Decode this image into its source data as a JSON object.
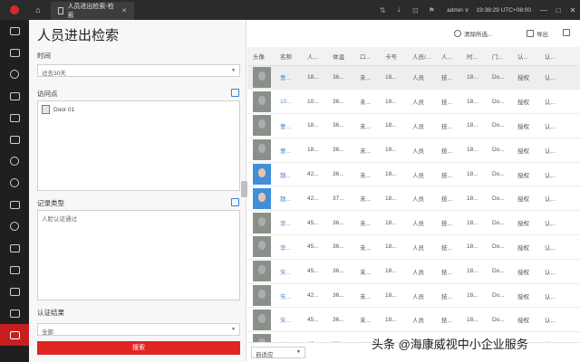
{
  "titlebar": {
    "tab_label": "人员进出检索-检索",
    "user": "admin",
    "clock": "19:38:29 UTC+08:00"
  },
  "left_rail": {
    "items": [
      "monitor-icon",
      "camera-icon",
      "map-icon",
      "image-icon",
      "report-icon",
      "event-icon",
      "face-icon",
      "person-icon",
      "document-icon",
      "time-icon",
      "vehicle-icon",
      "access-icon",
      "user-icon"
    ]
  },
  "search": {
    "page_title": "人员进出检索",
    "time_label": "时间",
    "time_value": "过去30天",
    "access_point_label": "访问点",
    "door": "Door 01",
    "record_type_label": "记录类型",
    "record_type_value": "人脸认证通过",
    "auth_result_label": "认证结果",
    "auth_result_value": "全部",
    "search_button": "搜索"
  },
  "toolbar": {
    "clear_filter": "清除所选...",
    "export": "导出"
  },
  "table": {
    "columns": [
      "头像",
      "名称",
      "人...",
      "体温",
      "口...",
      "卡号",
      "人员/...",
      "人...",
      "时...",
      "门...",
      "认...",
      "认..."
    ],
    "rows": [
      {
        "avatar": "gray",
        "name": "曹...",
        "c2": "18...",
        "temp": "36...",
        "mask": "未...",
        "card": "18...",
        "type": "人员",
        "c7": "技...",
        "time": "18...",
        "door": "Do...",
        "r1": "授权",
        "r2": "认...",
        "hl": true
      },
      {
        "avatar": "gray",
        "name": "10...",
        "c2": "10...",
        "temp": "36...",
        "mask": "未...",
        "card": "18...",
        "type": "人员",
        "c7": "技...",
        "time": "18...",
        "door": "Do...",
        "r1": "授权",
        "r2": "认..."
      },
      {
        "avatar": "gray",
        "name": "曹...",
        "c2": "18...",
        "temp": "36...",
        "mask": "未...",
        "card": "18...",
        "type": "人员",
        "c7": "技...",
        "time": "18...",
        "door": "Do...",
        "r1": "授权",
        "r2": "认..."
      },
      {
        "avatar": "gray",
        "name": "曹...",
        "c2": "18...",
        "temp": "36...",
        "mask": "未...",
        "card": "18...",
        "type": "人员",
        "c7": "技...",
        "time": "18...",
        "door": "Do...",
        "r1": "授权",
        "r2": "认..."
      },
      {
        "avatar": "blue",
        "name": "魏...",
        "c2": "42...",
        "temp": "36...",
        "mask": "未...",
        "card": "18...",
        "type": "人员",
        "c7": "技...",
        "time": "18...",
        "door": "Do...",
        "r1": "授权",
        "r2": "认..."
      },
      {
        "avatar": "blue",
        "name": "魏...",
        "c2": "42...",
        "temp": "37...",
        "mask": "未...",
        "card": "18...",
        "type": "人员",
        "c7": "技...",
        "time": "18...",
        "door": "Do...",
        "r1": "授权",
        "r2": "认..."
      },
      {
        "avatar": "gray",
        "name": "李...",
        "c2": "45...",
        "temp": "36...",
        "mask": "未...",
        "card": "18...",
        "type": "人员",
        "c7": "技...",
        "time": "18...",
        "door": "Do...",
        "r1": "授权",
        "r2": "认..."
      },
      {
        "avatar": "gray",
        "name": "李...",
        "c2": "45...",
        "temp": "36...",
        "mask": "未...",
        "card": "18...",
        "type": "人员",
        "c7": "技...",
        "time": "18...",
        "door": "Do...",
        "r1": "授权",
        "r2": "认..."
      },
      {
        "avatar": "gray",
        "name": "朱...",
        "c2": "45...",
        "temp": "36...",
        "mask": "未...",
        "card": "18...",
        "type": "人员",
        "c7": "技...",
        "time": "18...",
        "door": "Do...",
        "r1": "授权",
        "r2": "认..."
      },
      {
        "avatar": "gray",
        "name": "朱...",
        "c2": "42...",
        "temp": "36...",
        "mask": "未...",
        "card": "18...",
        "type": "人员",
        "c7": "技...",
        "time": "18...",
        "door": "Do...",
        "r1": "授权",
        "r2": "认..."
      },
      {
        "avatar": "gray",
        "name": "朱...",
        "c2": "45...",
        "temp": "36...",
        "mask": "未...",
        "card": "18...",
        "type": "人员",
        "c7": "技...",
        "time": "18...",
        "door": "Do...",
        "r1": "授权",
        "r2": "认..."
      },
      {
        "avatar": "gray",
        "name": "朱...",
        "c2": "42...",
        "temp": "36...",
        "mask": "未...",
        "card": "18...",
        "type": "人员",
        "c7": "技...",
        "time": "18...",
        "door": "Do...",
        "r1": "授权",
        "r2": "认..."
      }
    ]
  },
  "footer": {
    "fit_select": "自适应"
  },
  "watermark": "头条 @海康威视中小企业服务",
  "colors": {
    "accent": "#e02424",
    "titlebar": "#2b2b2b",
    "rail": "#1f1f1f",
    "link": "#3a7fd5"
  }
}
